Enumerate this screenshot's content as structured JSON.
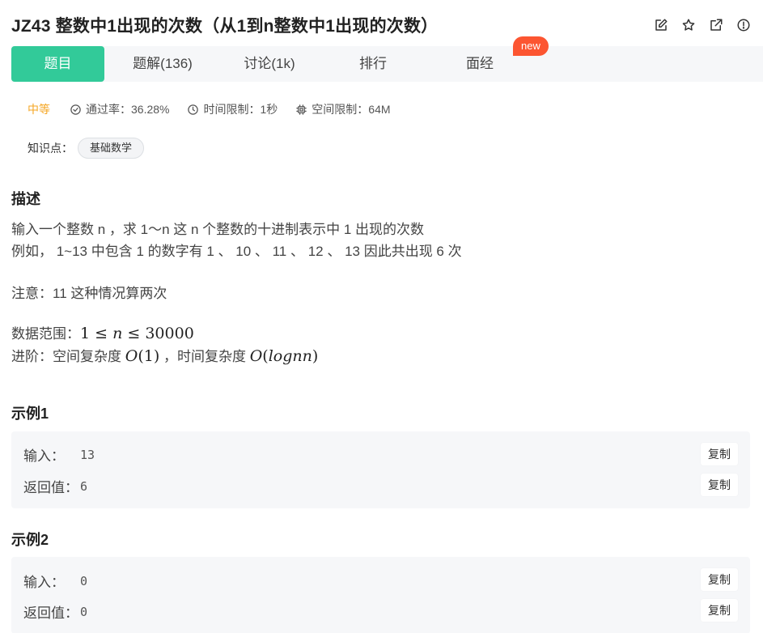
{
  "header": {
    "title": "JZ43  整数中1出现的次数（从1到n整数中1出现的次数）",
    "icons": [
      "edit-icon",
      "star-icon",
      "external-link-icon",
      "report-icon"
    ]
  },
  "tabs": [
    {
      "label": "题目",
      "active": true
    },
    {
      "label": "题解(136)",
      "active": false
    },
    {
      "label": "讨论(1k)",
      "active": false
    },
    {
      "label": "排行",
      "active": false
    },
    {
      "label": "面经",
      "active": false
    }
  ],
  "new_badge": "new",
  "meta": {
    "difficulty": "中等",
    "pass_rate": "通过率：36.28%",
    "time_limit": "时间限制：1秒",
    "space_limit": "空间限制：64M"
  },
  "knowledge": {
    "label": "知识点：",
    "tag": "基础数学"
  },
  "description": {
    "title": "描述",
    "line1": "输入一个整数 n ，求 1～n 这 n 个整数的十进制表示中 1 出现的次数",
    "line2": "例如， 1~13 中包含 1 的数字有 1 、 10 、 11 、 12 、 13 因此共出现 6 次",
    "line3": "注意：11 这种情况算两次",
    "range_label": "数据范围：",
    "range_math_pre": "1 ≤ ",
    "range_math_var": "n",
    "range_math_post": " ≤ 30000",
    "advance_label": "进阶：空间复杂度 ",
    "advance_space_O": "O",
    "advance_space_arg": "(1)",
    "advance_mid": " ，时间复杂度 ",
    "advance_time_O": "O",
    "advance_time_arg_open": "(",
    "advance_time_arg_var": "lognn",
    "advance_time_arg_close": ")"
  },
  "examples": [
    {
      "title": "示例1",
      "input_label": "输入：",
      "input_value": "13",
      "output_label": "返回值：",
      "output_value": "6",
      "copy_label": "复制"
    },
    {
      "title": "示例2",
      "input_label": "输入：",
      "input_value": "0",
      "output_label": "返回值：",
      "output_value": "0",
      "copy_label": "复制"
    }
  ],
  "colors": {
    "accent": "#32ca99",
    "badge": "#fc5531",
    "difficulty": "#f5a623"
  }
}
